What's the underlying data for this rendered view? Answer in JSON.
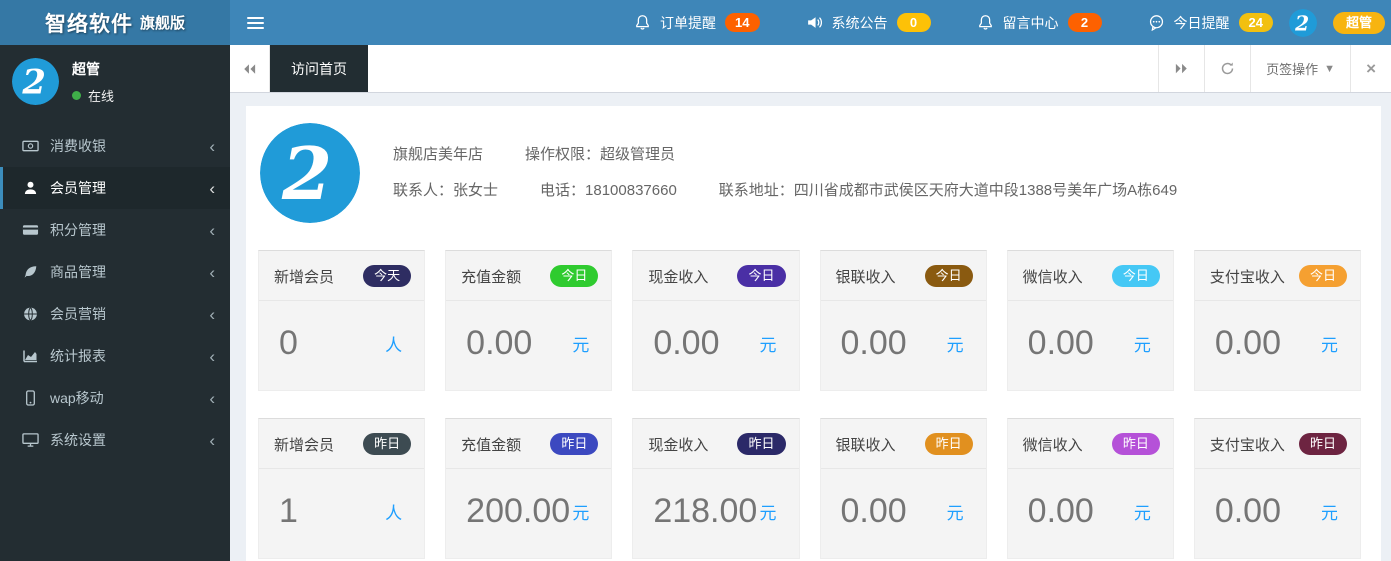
{
  "topbar": {
    "logo_main": "智络软件",
    "logo_sub": "旗舰版",
    "nav_items": [
      {
        "label": "订单提醒",
        "count": "14",
        "badge_color": "#fd6100",
        "icon": "bell-icon"
      },
      {
        "label": "系统公告",
        "count": "0",
        "badge_color": "#fdc107",
        "icon": "speaker-icon"
      },
      {
        "label": "留言中心",
        "count": "2",
        "badge_color": "#fd6100",
        "icon": "bell-icon"
      },
      {
        "label": "今日提醒",
        "count": "24",
        "badge_color": "#f2c010",
        "icon": "comment-icon"
      }
    ],
    "user_badge": "超管"
  },
  "sidebar": {
    "user": {
      "name": "超管",
      "status": "在线"
    },
    "items": [
      {
        "label": "消费收银",
        "icon": "money-icon",
        "active": false
      },
      {
        "label": "会员管理",
        "icon": "user-icon",
        "active": true
      },
      {
        "label": "积分管理",
        "icon": "credit-card-icon",
        "active": false
      },
      {
        "label": "商品管理",
        "icon": "leaf-icon",
        "active": false
      },
      {
        "label": "会员营销",
        "icon": "globe-icon",
        "active": false
      },
      {
        "label": "统计报表",
        "icon": "chart-icon",
        "active": false
      },
      {
        "label": "wap移动",
        "icon": "mobile-icon",
        "active": false
      },
      {
        "label": "系统设置",
        "icon": "desktop-icon",
        "active": false
      }
    ]
  },
  "tabbar": {
    "active_tab": "访问首页",
    "actions_label": "页签操作"
  },
  "store": {
    "name": "旗舰店美年店",
    "permission": "操作权限：超级管理员",
    "contact": "联系人：张女士",
    "phone": "电话：18100837660",
    "address": "联系地址：四川省成都市武侯区天府大道中段1388号美年广场A栋649"
  },
  "stat_cards": [
    [
      {
        "label": "新增会员",
        "badge": "今天",
        "badge_color": "#2e2d62",
        "value": "0",
        "unit": "人"
      },
      {
        "label": "充值金额",
        "badge": "今日",
        "badge_color": "#2fcb2f",
        "value": "0.00",
        "unit": "元"
      },
      {
        "label": "现金收入",
        "badge": "今日",
        "badge_color": "#4a2fa5",
        "value": "0.00",
        "unit": "元"
      },
      {
        "label": "银联收入",
        "badge": "今日",
        "badge_color": "#8a5a10",
        "value": "0.00",
        "unit": "元"
      },
      {
        "label": "微信收入",
        "badge": "今日",
        "badge_color": "#45c8f5",
        "value": "0.00",
        "unit": "元"
      },
      {
        "label": "支付宝收入",
        "badge": "今日",
        "badge_color": "#f5a031",
        "value": "0.00",
        "unit": "元"
      }
    ],
    [
      {
        "label": "新增会员",
        "badge": "昨日",
        "badge_color": "#3d4b52",
        "value": "1",
        "unit": "人"
      },
      {
        "label": "充值金额",
        "badge": "昨日",
        "badge_color": "#3c49c0",
        "value": "200.00",
        "unit": "元"
      },
      {
        "label": "现金收入",
        "badge": "昨日",
        "badge_color": "#2b2968",
        "value": "218.00",
        "unit": "元"
      },
      {
        "label": "银联收入",
        "badge": "昨日",
        "badge_color": "#e1901f",
        "value": "0.00",
        "unit": "元"
      },
      {
        "label": "微信收入",
        "badge": "昨日",
        "badge_color": "#b551d8",
        "value": "0.00",
        "unit": "元"
      },
      {
        "label": "支付宝收入",
        "badge": "昨日",
        "badge_color": "#6d2441",
        "value": "0.00",
        "unit": "元"
      }
    ]
  ],
  "colors": {
    "topbar_bg": "#3e86b8",
    "logo_bg": "#3578a5",
    "sidebar_bg": "#232d32",
    "accent": "#3c8dbc",
    "unit_blue": "#1e9fff",
    "online_green": "#3fae49",
    "logo_circle_blue": "#209bd8"
  }
}
